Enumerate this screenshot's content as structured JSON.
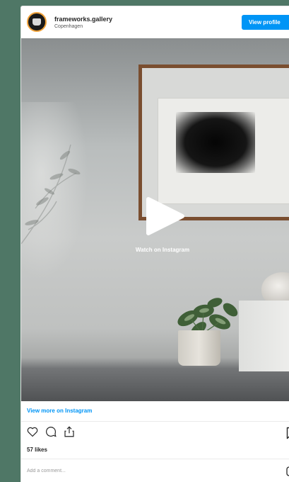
{
  "header": {
    "username": "frameworks.gallery",
    "location": "Copenhagen",
    "view_profile_label": "View profile"
  },
  "media": {
    "overlay_label": "Watch on Instagram"
  },
  "footer": {
    "view_more_label": "View more on Instagram",
    "likes_text": "57 likes",
    "comment_placeholder": "Add a comment..."
  },
  "icons": {
    "like": "heart-icon",
    "comment": "comment-icon",
    "share": "share-icon",
    "save": "bookmark-icon",
    "play": "play-icon"
  },
  "colors": {
    "background": "#4f7766",
    "accent": "#0095f6",
    "frame": "#7a4e30"
  }
}
